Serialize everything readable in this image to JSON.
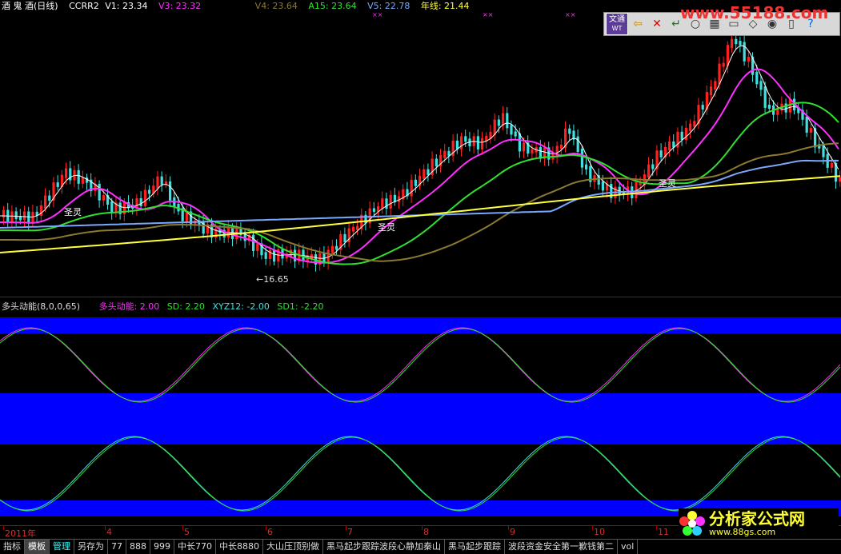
{
  "legend": {
    "stock_name": "酒 鬼 酒(日线)",
    "formula": "CCRR2",
    "v1": "V1: 23.34",
    "v3": "V3: 23.32",
    "v4": "V4: 23.64",
    "a15": "A15: 23.64",
    "v5": "V5: 22.78",
    "yearline": "年线: 21.44"
  },
  "annotations": {
    "low_price": "←16.65",
    "shengling_1": "圣灵",
    "shengling_2": "圣灵",
    "shengling_3": "圣灵",
    "marks": "××"
  },
  "indicator": {
    "name": "多头动能(8,0,0,65)",
    "dtdn": "多头动能: 2.00",
    "sd": "SD: 2.20",
    "xyz12": "XYZ12: -2.00",
    "sd1": "SD1: -2.20"
  },
  "date_axis": {
    "labels": [
      "2011年",
      "4",
      "5",
      "6",
      "7",
      "8",
      "9",
      "10",
      "11"
    ]
  },
  "tabs": [
    {
      "label": "指标"
    },
    {
      "label": "模板"
    },
    {
      "label": "管理"
    },
    {
      "label": "另存为"
    },
    {
      "label": "77"
    },
    {
      "label": "888"
    },
    {
      "label": "999"
    },
    {
      "label": "中长770"
    },
    {
      "label": "中长8880"
    },
    {
      "label": "大山压顶别做"
    },
    {
      "label": "黑马起步跟踪波段心静加秦山"
    },
    {
      "label": "黑马起步跟踪"
    },
    {
      "label": "波段资金安全第一歉钱第二"
    },
    {
      "label": "vol"
    }
  ],
  "toolbar": {
    "logo_line1": "文通",
    "logo_line2": "WT"
  },
  "watermarks": {
    "top": "www.55188.com",
    "bottom_cn": "分析家公式网",
    "bottom_url": "www.88gs.com"
  },
  "colors": {
    "up": "#ff2020",
    "down": "#40e0e0",
    "ma_white": "#ffffff",
    "ma_magenta": "#ff30ff",
    "ma_green": "#30e030",
    "ma_blue": "#7aa8ff",
    "ma_olive": "#8a7a30",
    "yearline": "#ffff40",
    "band": "#0000ff"
  }
}
